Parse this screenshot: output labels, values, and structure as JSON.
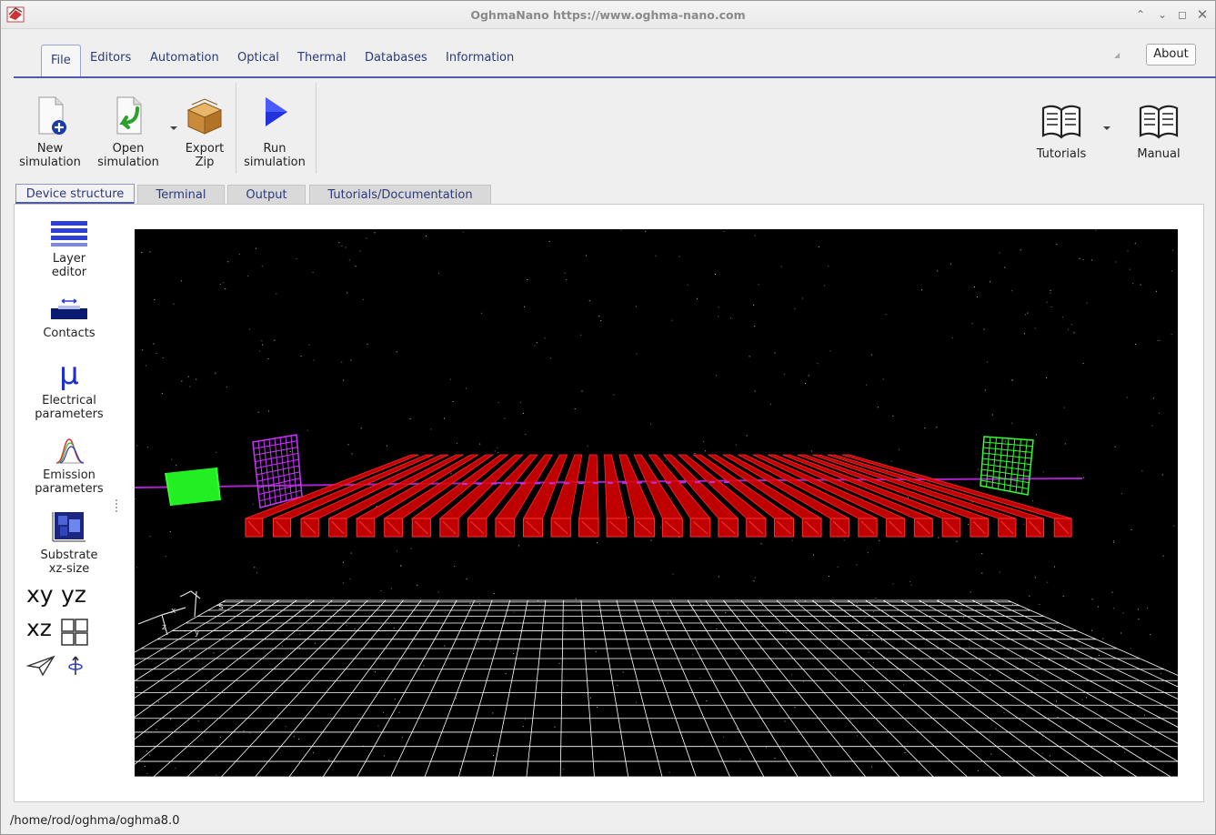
{
  "window": {
    "title": "OghmaNano https://www.oghma-nano.com",
    "controls": [
      "chevron-up-icon",
      "minimize-icon",
      "maximize-icon",
      "close-icon"
    ]
  },
  "menu": {
    "tabs": [
      {
        "label": "File",
        "active": true
      },
      {
        "label": "Editors"
      },
      {
        "label": "Automation"
      },
      {
        "label": "Optical"
      },
      {
        "label": "Thermal"
      },
      {
        "label": "Databases"
      },
      {
        "label": "Information"
      }
    ],
    "about_label": "About"
  },
  "toolbar": {
    "new_sim": "New\nsimulation",
    "open_sim": "Open\nsimulation",
    "export_zip": "Export\nZip",
    "run_sim": "Run\nsimulation",
    "tutorials": "Tutorials",
    "manual": "Manual"
  },
  "subtabs": [
    {
      "label": "Device structure",
      "active": true
    },
    {
      "label": "Terminal"
    },
    {
      "label": "Output"
    },
    {
      "label": "Tutorials/Documentation"
    }
  ],
  "sidebar": {
    "layer_editor": "Layer\neditor",
    "contacts": "Contacts",
    "electrical_symbol": "μ",
    "electrical": "Electrical\nparameters",
    "emission": "Emission\nparameters",
    "substrate": "Substrate\nxz-size",
    "view_xy": "xy",
    "view_yz": "yz",
    "view_xz": "xz"
  },
  "viewport": {
    "axis_labels": [
      "x",
      "y",
      "z",
      "s"
    ],
    "colors": {
      "background": "#000000",
      "bars": "#e00000",
      "detector_magenta": "#cc33ff",
      "detector_green": "#33ff33",
      "grid": "#ffffff",
      "beam": "#aa22cc"
    },
    "bar_count": 30
  },
  "status": {
    "path": "/home/rod/oghma/oghma8.0"
  }
}
